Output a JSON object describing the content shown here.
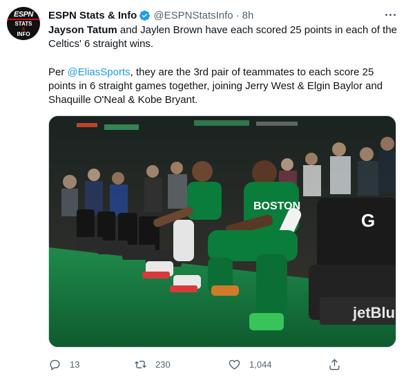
{
  "avatar": {
    "logo_top": "ESPN",
    "logo_line1": "STATS",
    "logo_amp": "&",
    "logo_line2": "INFO"
  },
  "author": {
    "name": "ESPN Stats & Info",
    "handle": "@ESPNStatsInfo",
    "separator": "·",
    "time": "8h"
  },
  "tweet": {
    "p1_bold": "Jayson Tatum",
    "p1_rest": " and Jaylen Brown have each scored 25 points in each of the Celtics' 6 straight wins.",
    "p2_pre": "Per ",
    "p2_mention": "@EliasSports",
    "p2_rest": ", they are the 3rd pair of teammates to each score 25 points in 6 straight games together, joining Jerry West & Elgin Baylor and Shaquille O'Neal & Kobe Bryant."
  },
  "photo": {
    "jersey_text": "BOSTON",
    "chair_text": "jetBlue",
    "gatorade_text": "G"
  },
  "actions": {
    "reply_count": "13",
    "retweet_count": "230",
    "like_count": "1,044"
  },
  "colors": {
    "link": "#1d9bf0",
    "secondary": "#536471",
    "celtics_green": "#007a33",
    "verified": "#1d9bf0"
  },
  "icons": {
    "verified": "verified-badge-icon",
    "more": "more-dots-icon",
    "reply": "reply-icon",
    "retweet": "retweet-icon",
    "like": "heart-icon",
    "share": "share-icon"
  }
}
